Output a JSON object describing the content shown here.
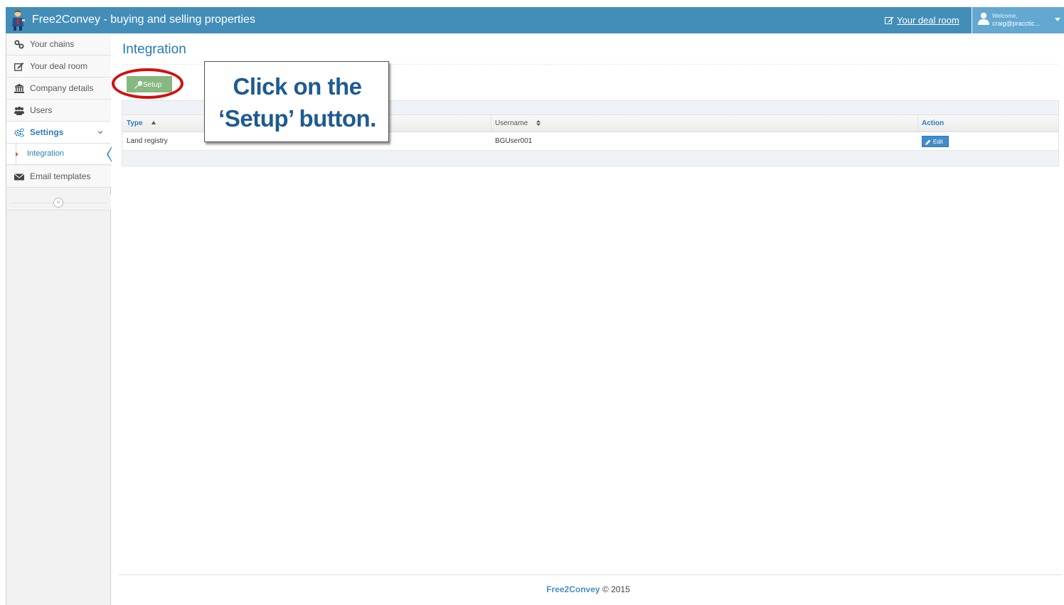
{
  "header": {
    "app_title": "Free2Convey - buying and selling properties",
    "deal_room_link": "Your deal room",
    "welcome": "Welcome,",
    "user_email": "craig@pracctic..."
  },
  "sidebar": {
    "items": [
      {
        "label": "Your chains",
        "icon": "link-icon"
      },
      {
        "label": "Your deal room",
        "icon": "edit-icon"
      },
      {
        "label": "Company details",
        "icon": "bank-icon"
      },
      {
        "label": "Users",
        "icon": "users-icon"
      },
      {
        "label": "Settings",
        "icon": "cogs-icon"
      },
      {
        "label": "Integration",
        "icon": "caret-right-icon"
      },
      {
        "label": "Email templates",
        "icon": "envelope-icon"
      }
    ],
    "collapse_symbol": "«"
  },
  "main": {
    "page_title": "Integration",
    "setup_label": "Setup",
    "table": {
      "headers": [
        "Type",
        "Username",
        "Action"
      ],
      "rows": [
        {
          "type": "Land registry",
          "username": "BGUser001",
          "action": "Edit"
        }
      ]
    }
  },
  "callout": {
    "line1": "Click on the",
    "line2": "‘Setup’ button."
  },
  "footer": {
    "brand": "Free2Convey",
    "copyright": " © 2015"
  },
  "colors": {
    "topbar": "#438eb9",
    "accent": "#2b7dbc",
    "setup_button": "#87b87f",
    "highlight_ring": "#d01010",
    "callout_text": "#1f5a92"
  }
}
